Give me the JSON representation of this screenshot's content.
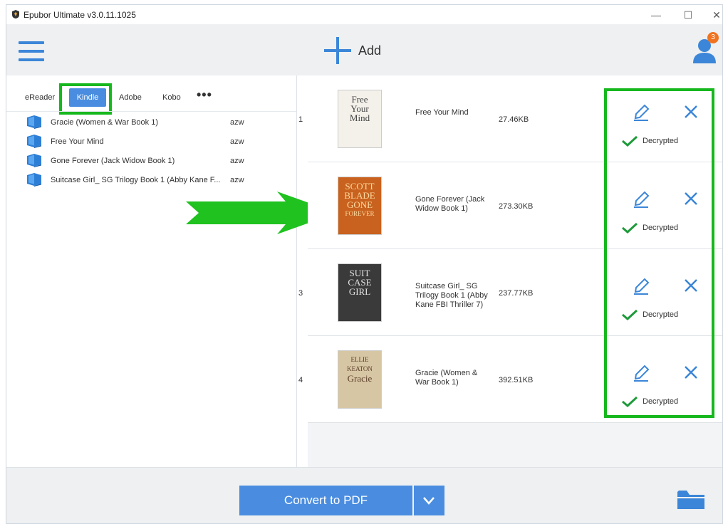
{
  "window": {
    "title": "Epubor Ultimate v3.0.11.1025",
    "minimize": "—",
    "maximize": "☐",
    "close": "✕"
  },
  "toolbar": {
    "add_label": "Add",
    "notification_count": "3"
  },
  "tabs": [
    {
      "label": "eReader"
    },
    {
      "label": "Kindle",
      "selected": true
    },
    {
      "label": "Adobe"
    },
    {
      "label": "Kobo"
    },
    {
      "label": "•••"
    }
  ],
  "library": [
    {
      "title": "Gracie (Women & War Book 1)",
      "format": "azw"
    },
    {
      "title": "Free Your Mind",
      "format": "azw"
    },
    {
      "title": "Gone Forever (Jack Widow Book 1)",
      "format": "azw"
    },
    {
      "title": "Suitcase Girl_ SG Trilogy Book 1 (Abby Kane F...",
      "format": "azw"
    }
  ],
  "queue": [
    {
      "index": "1",
      "title": "Free Your Mind",
      "size": "27.46KB",
      "status": "Decrypted",
      "cover": {
        "lines": [
          "Free",
          "Your",
          "Mind"
        ],
        "bg": "#f4f1ea",
        "fg": "#444"
      }
    },
    {
      "index": "",
      "title": "Gone Forever (Jack Widow Book 1)",
      "size": "273.30KB",
      "status": "Decrypted",
      "cover": {
        "lines": [
          "SCOTT",
          "BLADE",
          "GONE",
          "FOREVER"
        ],
        "bg": "#c8621e",
        "fg": "#ffd9a0"
      }
    },
    {
      "index": "3",
      "title": "Suitcase Girl_ SG Trilogy Book 1 (Abby Kane FBI Thriller 7)",
      "size": "237.77KB",
      "status": "Decrypted",
      "cover": {
        "lines": [
          "SUIT",
          "CASE",
          "GIRL"
        ],
        "bg": "#3a3a3a",
        "fg": "#e6e6e6"
      }
    },
    {
      "index": "4",
      "title": "Gracie (Women & War Book 1)",
      "size": "392.51KB",
      "status": "Decrypted",
      "cover": {
        "lines": [
          "ELLIE KEATON",
          "Gracie"
        ],
        "bg": "#d7c6a4",
        "fg": "#5a3d2a"
      }
    }
  ],
  "bottom": {
    "convert_label": "Convert to PDF"
  },
  "colors": {
    "accent": "#4a8de0",
    "highlight": "#17b81e",
    "badge": "#f07320",
    "check": "#1e9a3a"
  }
}
